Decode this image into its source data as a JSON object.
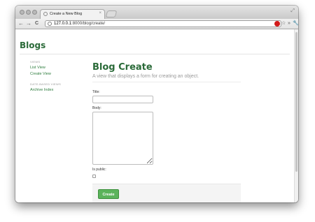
{
  "browser": {
    "tab_title": "Create a New Blog",
    "tab_close": "×",
    "url_host": "127.0.0.1",
    "url_rest": ":8000/blog/create/",
    "back": "←",
    "forward": "→",
    "reload": "C",
    "star": "☆",
    "menu": "»",
    "wrench": "🔧",
    "resize": "⤢"
  },
  "app": {
    "brand": "Blogs"
  },
  "sidebar": {
    "sections": [
      {
        "heading": "VIEWS",
        "links": [
          "List View",
          "Create View"
        ]
      },
      {
        "heading": "DATE-BASED VIEWS",
        "links": [
          "Archive Index"
        ]
      }
    ]
  },
  "main": {
    "title": "Blog Create",
    "subtitle": "A view that displays a form for creating an object.",
    "form": {
      "title_label": "Title:",
      "title_value": "",
      "body_label": "Body:",
      "body_value": "",
      "is_public_label": "Is public:",
      "is_public_checked": false,
      "submit_label": "Create"
    }
  },
  "colors": {
    "brand_green": "#2c6b3a",
    "link_green": "#2e7d3e",
    "button_green": "#5bb35b"
  }
}
